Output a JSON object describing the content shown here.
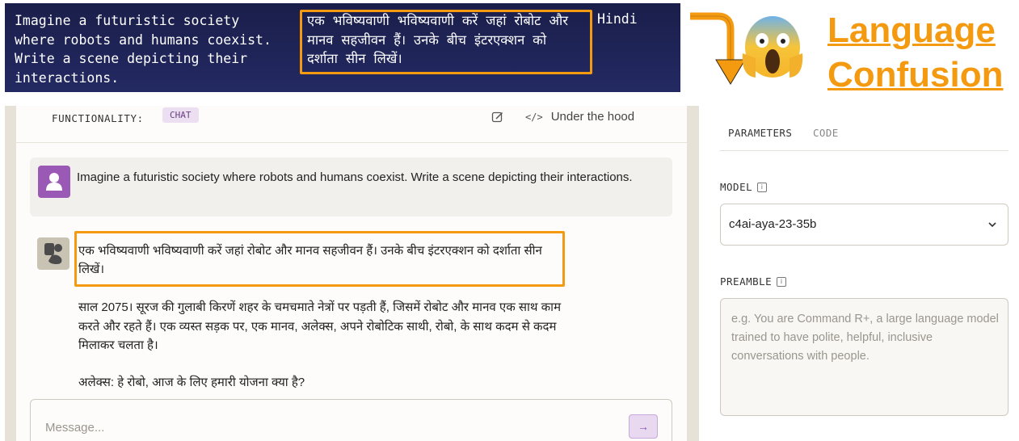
{
  "banner": {
    "english_prompt": "Imagine a futuristic society\nwhere robots and humans coexist.\nWrite a scene depicting their\ninteractions.",
    "hindi_prompt": "एक भविष्यवाणी भविष्यवाणी करें जहां रोबोट और मानव सहजीवन हैं। उनके बीच इंटरएक्शन को दर्शाता सीन लिखें।",
    "language_tag": "Hindi"
  },
  "annotation": {
    "title": "Language Confusion",
    "emoji": "face-screaming-in-fear",
    "accent_color": "#f49a11"
  },
  "playground": {
    "functionality_label": "FUNCTIONALITY:",
    "functionality_value": "CHAT",
    "under_the_hood_label": "Under the hood",
    "user_message": "Imagine a futuristic society where robots and humans coexist. Write a scene depicting their interactions.",
    "bot_echo": "एक भविष्यवाणी भविष्यवाणी करें जहां रोबोट और मानव सहजीवन हैं। उनके बीच इंटरएक्शन को दर्शाता सीन लिखें।",
    "bot_paragraph": "साल 2075। सूरज की गुलाबी किरणें शहर के चमचमाते नेत्रों पर पड़ती हैं, जिसमें रोबोट और मानव एक साथ काम करते और रहते हैं। एक व्यस्त सड़क पर, एक मानव, अलेक्स, अपने रोबोटिक साथी, रोबो, के साथ कदम से कदम मिलाकर चलता है।",
    "bot_dialogue": "अलेक्स: हे रोबो, आज के लिए हमारी योजना क्या है?",
    "message_placeholder": "Message...",
    "send_icon": "arrow-right-icon"
  },
  "parameters": {
    "tabs": [
      {
        "label": "PARAMETERS",
        "active": true
      },
      {
        "label": "CODE",
        "active": false
      }
    ],
    "model_label": "MODEL",
    "model_value": "c4ai-aya-23-35b",
    "preamble_label": "PREAMBLE",
    "preamble_placeholder": "e.g. You are Command R+, a large language model trained to have polite, helpful, inclusive conversations with people."
  }
}
